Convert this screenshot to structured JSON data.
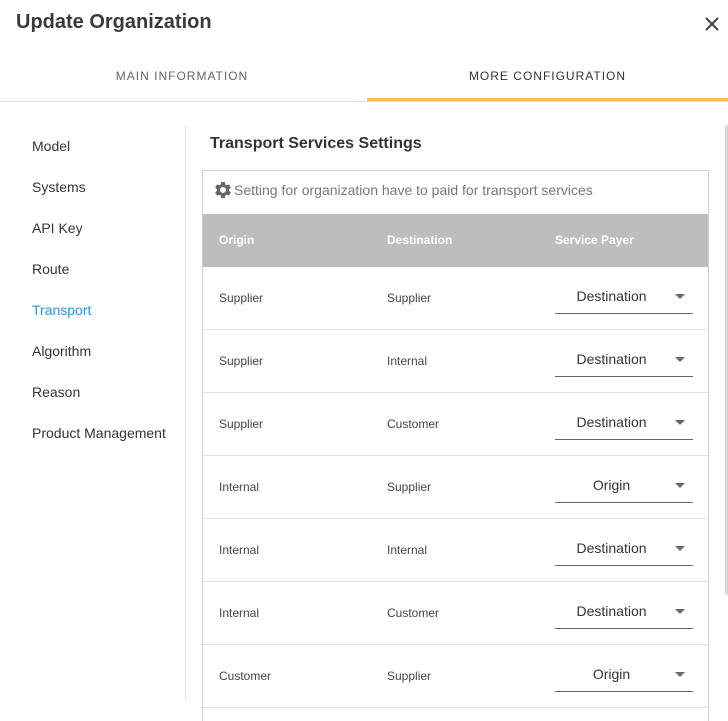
{
  "dialog": {
    "title": "Update Organization"
  },
  "tabs": [
    {
      "label": "MAIN INFORMATION"
    },
    {
      "label": "MORE CONFIGURATION"
    }
  ],
  "sidebar": {
    "items": [
      {
        "label": "Model"
      },
      {
        "label": "Systems"
      },
      {
        "label": "API Key"
      },
      {
        "label": "Route"
      },
      {
        "label": "Transport"
      },
      {
        "label": "Algorithm"
      },
      {
        "label": "Reason"
      },
      {
        "label": "Product Management"
      }
    ],
    "active": "Transport"
  },
  "section": {
    "title": "Transport Services Settings",
    "hint": "Setting for organization have to paid for transport services"
  },
  "table": {
    "columns": [
      "Origin",
      "Destination",
      "Service Payer"
    ],
    "rows": [
      {
        "origin": "Supplier",
        "destination": "Supplier",
        "payer": "Destination"
      },
      {
        "origin": "Supplier",
        "destination": "Internal",
        "payer": "Destination"
      },
      {
        "origin": "Supplier",
        "destination": "Customer",
        "payer": "Destination"
      },
      {
        "origin": "Internal",
        "destination": "Supplier",
        "payer": "Origin"
      },
      {
        "origin": "Internal",
        "destination": "Internal",
        "payer": "Destination"
      },
      {
        "origin": "Internal",
        "destination": "Customer",
        "payer": "Destination"
      },
      {
        "origin": "Customer",
        "destination": "Supplier",
        "payer": "Origin"
      }
    ]
  },
  "colors": {
    "accent": "#f2c14e",
    "active_link": "#2196f3",
    "table_header": "#bdbdbd"
  },
  "icons": {
    "close": "close-icon",
    "settings": "gear-icon",
    "dropdown": "chevron-down-icon"
  }
}
